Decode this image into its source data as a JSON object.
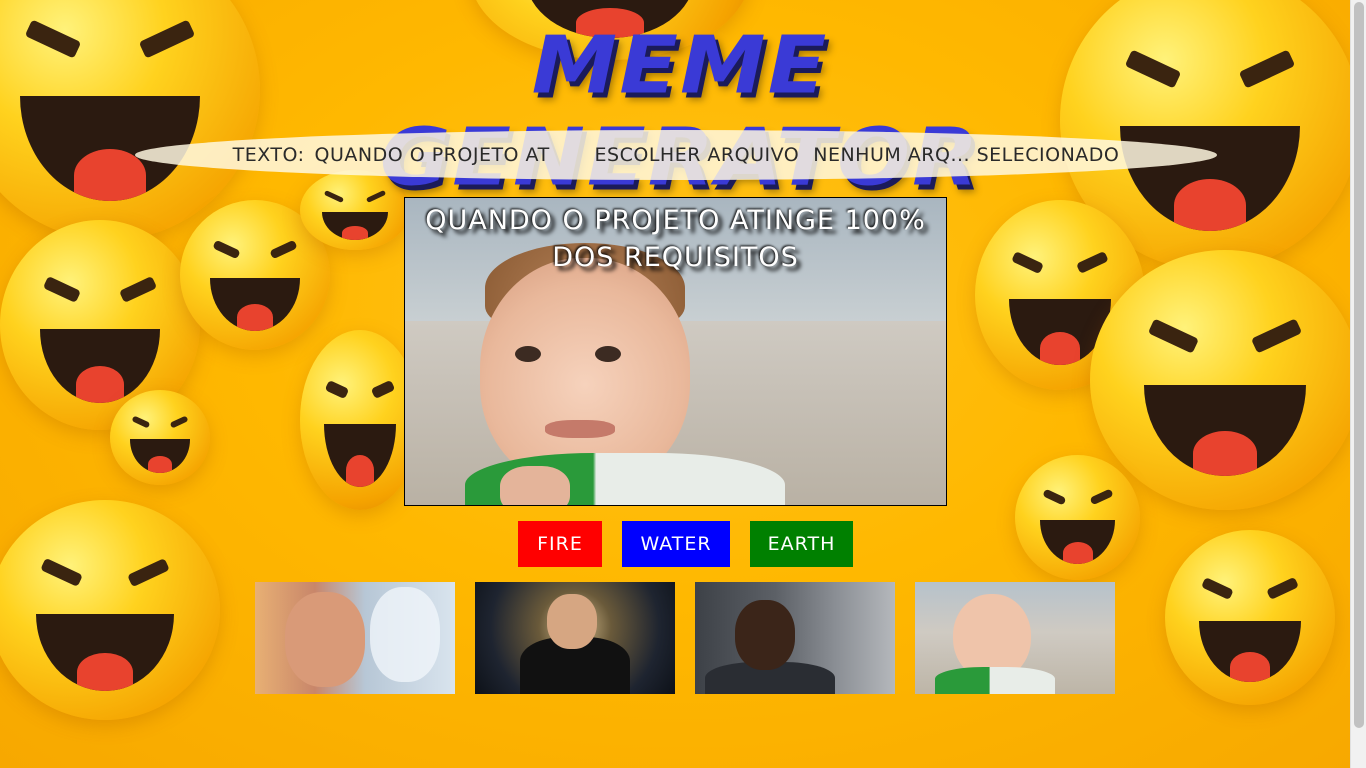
{
  "header": {
    "title": "MEME GENERATOR"
  },
  "controls": {
    "text_label": "TEXTO:",
    "text_value": "QUANDO O PROJETO AT",
    "file_button_label": "ESCOLHER ARQUIVO",
    "file_status": "NENHUM ARQ... SELECIONADO"
  },
  "meme": {
    "text": "QUANDO O PROJETO ATINGE 100% DOS REQUISITOS"
  },
  "border_buttons": [
    {
      "label": "FIRE",
      "color": "#ff0000"
    },
    {
      "label": "WATER",
      "color": "#0000ff"
    },
    {
      "label": "EARTH",
      "color": "#008000"
    }
  ],
  "colors": {
    "title": "#3a3ad6",
    "background": "#ffb800"
  }
}
